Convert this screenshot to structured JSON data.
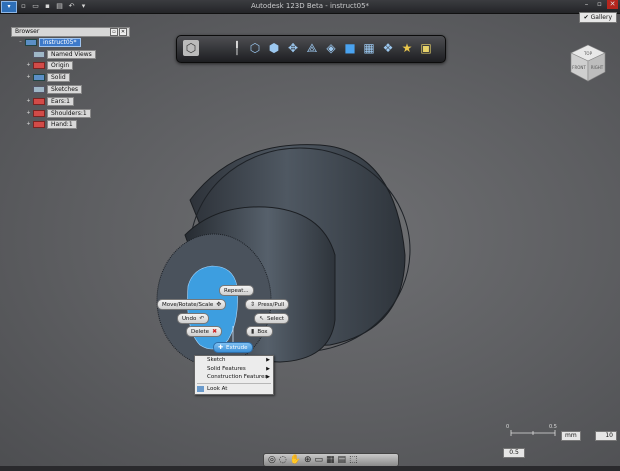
{
  "app": {
    "title": "Autodesk 123D Beta - instruct05*",
    "app_button_icon": "app-menu-icon",
    "quick_access": [
      "new-icon",
      "open-icon",
      "save-icon",
      "print-icon",
      "undo-icon",
      "redo-icon"
    ],
    "gallery_label": "Gallery",
    "window_controls": [
      "minimize-icon",
      "maximize-icon",
      "close-icon"
    ]
  },
  "browser": {
    "title": "Browser",
    "root": "instruct05*",
    "nodes": [
      {
        "label": "Named Views",
        "icon": "folder-icon"
      },
      {
        "label": "Origin",
        "icon": "hidden-icon"
      },
      {
        "label": "Solid",
        "icon": "eye-icon"
      },
      {
        "label": "Sketches",
        "icon": "folder-icon"
      },
      {
        "label": "Ears:1",
        "icon": "component-icon"
      },
      {
        "label": "Shoulders:1",
        "icon": "component-icon"
      },
      {
        "label": "Hand:1",
        "icon": "component-icon"
      }
    ]
  },
  "toolbar": {
    "items": [
      "home-view-icon",
      "info-icon",
      "primitives-icon",
      "box-icon",
      "transform-icon",
      "sketch-icon",
      "modify-icon",
      "pattern-icon",
      "group-icon",
      "measure-icon",
      "grid-snap-icon",
      "material-icon"
    ]
  },
  "viewcube": {
    "faces": [
      "TOP",
      "FRONT",
      "RIGHT"
    ]
  },
  "marking_menu": {
    "repeat": "Repeat...",
    "move": "Move/Rotate/Scale",
    "presspull": "Press/Pull",
    "undo": "Undo",
    "select": "Select",
    "delete": "Delete",
    "box": "Box",
    "extrude": "Extrude"
  },
  "context_menu": {
    "items": [
      {
        "label": "Sketch",
        "submenu": true
      },
      {
        "label": "Solid Features",
        "submenu": true
      },
      {
        "label": "Construction Features",
        "submenu": true
      },
      {
        "label": "Look At",
        "submenu": false
      }
    ]
  },
  "scale": {
    "ticks": [
      "0",
      "0.5"
    ],
    "unit": "mm",
    "value": "10",
    "tick_value": "0.5"
  },
  "nav_bar": {
    "items": [
      "orbit-icon",
      "look-at-icon",
      "pan-icon",
      "zoom-icon",
      "fit-icon",
      "display-icon",
      "grid-icon",
      "selection-icon"
    ]
  },
  "colors": {
    "face_select": "#3d9ee0",
    "model": "#3e454f",
    "accent": "#3d79c9"
  }
}
